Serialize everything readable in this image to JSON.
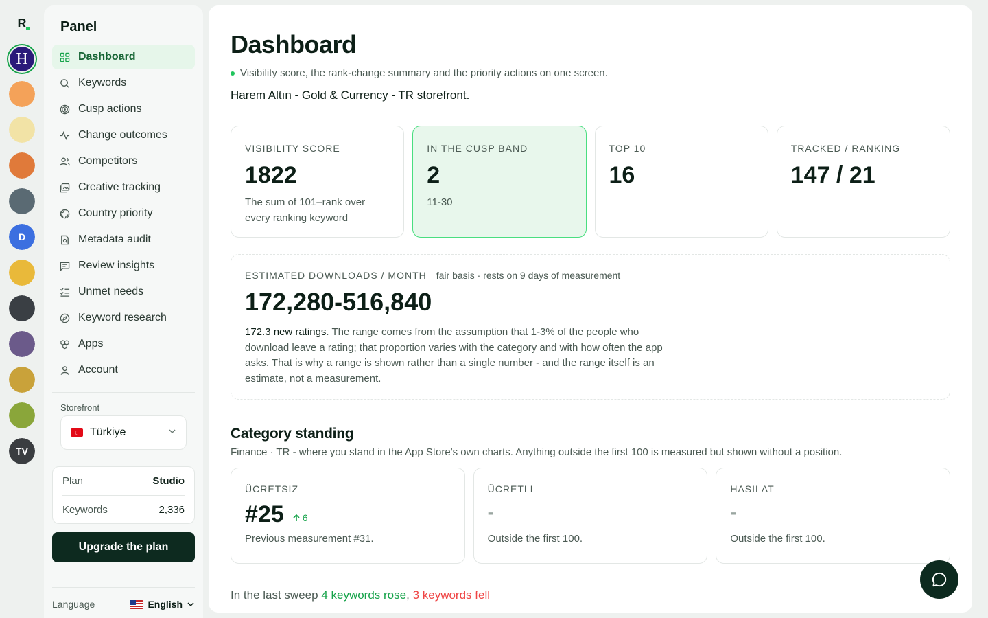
{
  "rail": {
    "brand": "R",
    "apps": [
      {
        "name": "harem-altin",
        "letter": "H",
        "bg": "#2a1a7a",
        "active": true
      },
      {
        "name": "subway-surfers",
        "letter": "",
        "bg": "#f4a259"
      },
      {
        "name": "altin-app",
        "letter": "",
        "bg": "#f2e3a6"
      },
      {
        "name": "block-puzzle",
        "letter": "",
        "bg": "#e07a3a"
      },
      {
        "name": "stocks-app",
        "letter": "",
        "bg": "#5a6a73"
      },
      {
        "name": "d-app",
        "letter": "D",
        "bg": "#3b6fe0"
      },
      {
        "name": "geometry-dash",
        "letter": "",
        "bg": "#e9b93a"
      },
      {
        "name": "investing",
        "letter": "",
        "bg": "#3a3f44"
      },
      {
        "name": "game-avatar",
        "letter": "",
        "bg": "#6b5a8a"
      },
      {
        "name": "temple-run",
        "letter": "",
        "bg": "#c9a23a"
      },
      {
        "name": "temple-run-2",
        "letter": "",
        "bg": "#8aa63a"
      },
      {
        "name": "tradingview",
        "letter": "TV",
        "bg": "#3a3d40"
      }
    ]
  },
  "sidebar": {
    "title": "Panel",
    "items": [
      {
        "label": "Dashboard",
        "icon": "grid-icon",
        "active": true
      },
      {
        "label": "Keywords",
        "icon": "search-icon"
      },
      {
        "label": "Cusp actions",
        "icon": "target-icon"
      },
      {
        "label": "Change outcomes",
        "icon": "activity-icon"
      },
      {
        "label": "Competitors",
        "icon": "users-icon"
      },
      {
        "label": "Creative tracking",
        "icon": "image-icon"
      },
      {
        "label": "Country priority",
        "icon": "globe-icon"
      },
      {
        "label": "Metadata audit",
        "icon": "file-search-icon"
      },
      {
        "label": "Review insights",
        "icon": "message-icon"
      },
      {
        "label": "Unmet needs",
        "icon": "list-check-icon"
      },
      {
        "label": "Keyword research",
        "icon": "compass-icon"
      },
      {
        "label": "Apps",
        "icon": "boxes-icon"
      },
      {
        "label": "Account",
        "icon": "user-icon"
      }
    ],
    "storefront_label": "Storefront",
    "storefront_value": "Türkiye",
    "plan_label": "Plan",
    "plan_value": "Studio",
    "keywords_label": "Keywords",
    "keywords_value": "2,336",
    "upgrade_label": "Upgrade the plan",
    "language_label": "Language",
    "language_value": "English"
  },
  "main": {
    "title": "Dashboard",
    "subtitle": "Visibility score, the rank-change summary and the priority actions on one screen.",
    "app_line": "Harem Altın - Gold & Currency - TR storefront.",
    "stats": [
      {
        "label": "VISIBILITY SCORE",
        "value": "1822",
        "note": "The sum of 101–rank over every ranking keyword"
      },
      {
        "label": "IN THE CUSP BAND",
        "value": "2",
        "note": "11-30"
      },
      {
        "label": "TOP 10",
        "value": "16",
        "note": ""
      },
      {
        "label": "TRACKED / RANKING",
        "value": "147 / 21",
        "note": ""
      }
    ],
    "estimate": {
      "label": "ESTIMATED DOWNLOADS / MONTH",
      "basis": "fair basis · rests on 9 days of measurement",
      "value": "172,280-516,840",
      "ratings": "172.3 new ratings",
      "text": ". The range comes from the assumption that 1-3% of the people who download leave a rating; that proportion varies with the category and with how often the app asks. That is why a range is shown rather than a single number - and the range itself is an estimate, not a measurement."
    },
    "category": {
      "title": "Category standing",
      "subtitle": "Finance · TR - where you stand in the App Store's own charts. Anything outside the first 100 is measured but shown without a position.",
      "cards": [
        {
          "label": "ÜCRETSIZ",
          "value": "#25",
          "delta": "6",
          "note": "Previous measurement #31."
        },
        {
          "label": "ÜCRETLI",
          "value": "-",
          "delta": "",
          "note": "Outside the first 100."
        },
        {
          "label": "HASILAT",
          "value": "-",
          "delta": "",
          "note": "Outside the first 100."
        }
      ]
    },
    "sweep": {
      "prefix": "In the last sweep",
      "rose": "4 keywords rose",
      "sep": ",",
      "fell": "3 keywords fell"
    }
  },
  "colors": {
    "accent": "#16a34a",
    "danger": "#ef4444",
    "dark": "#0d2a1f"
  }
}
